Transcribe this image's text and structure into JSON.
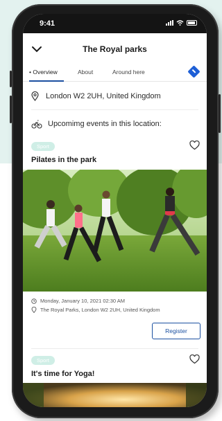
{
  "status_bar": {
    "time": "9:41"
  },
  "header": {
    "title": "The Royal parks"
  },
  "tabs": [
    {
      "label": "• Overview"
    },
    {
      "label": "About"
    },
    {
      "label": "Around here"
    }
  ],
  "location": {
    "address": "London W2 2UH, United Kingdom"
  },
  "events_heading": "Upcomimg events in this location:",
  "events": [
    {
      "badge": "Sport",
      "title": "Pilates in the park",
      "datetime": "Monday, January 10, 2021 02:30 AM",
      "place": "The Royal Parks, London W2 2UH, United Kingdom",
      "button": "Register"
    },
    {
      "badge": "Sport",
      "title": "It's time for Yoga!"
    }
  ],
  "colors": {
    "accent": "#1a4fa0",
    "badge_bg": "#cfeee6",
    "background_band": "#e3f2ef"
  },
  "icons": [
    "back-chevron-icon",
    "map-pin-icon",
    "bike-icon",
    "heart-icon",
    "clock-icon",
    "pin-icon",
    "directions-icon"
  ]
}
